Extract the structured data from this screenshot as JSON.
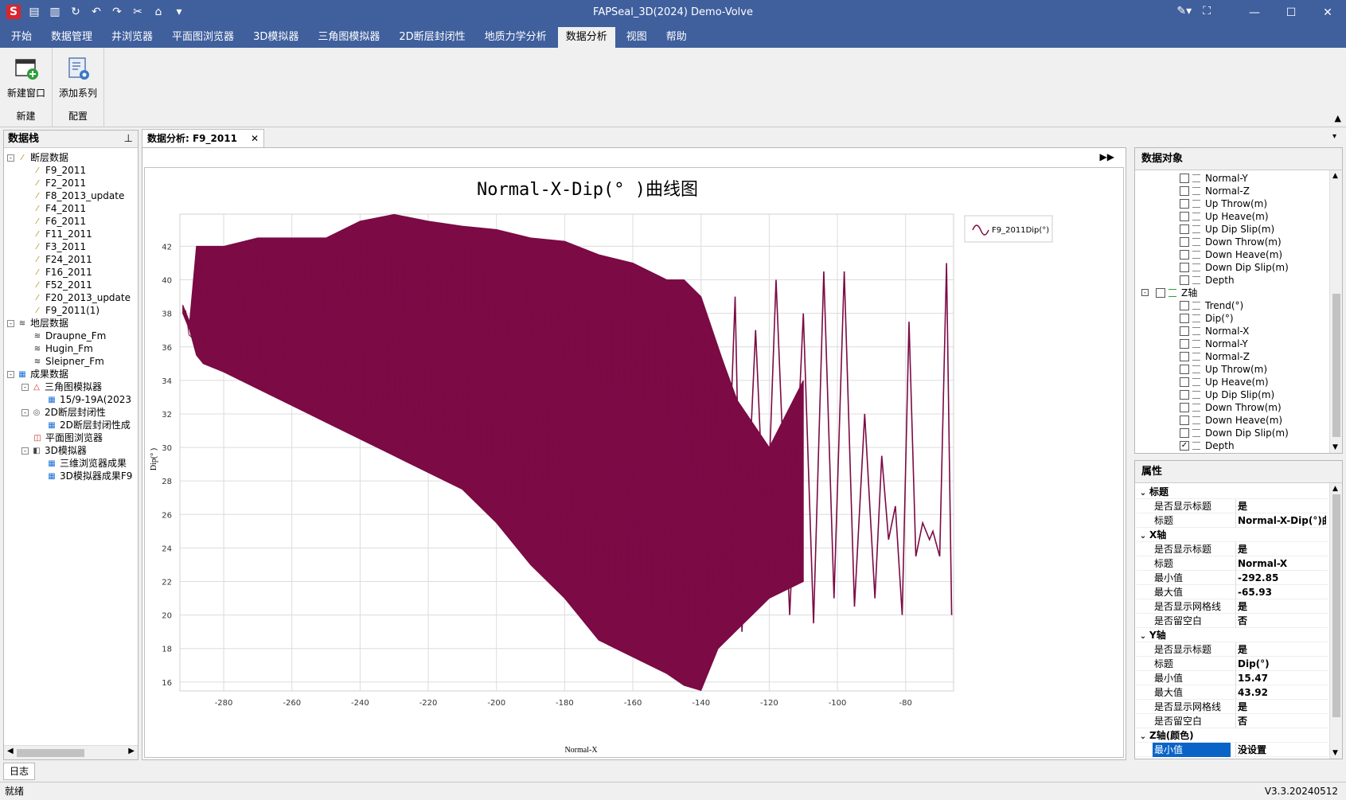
{
  "app": {
    "title": "FAPSeal_3D(2024) Demo-Volve",
    "logo": "S",
    "quick_access": [
      "save-icon",
      "save-all-icon",
      "refresh-icon",
      "undo-icon",
      "redo-icon",
      "cut-icon",
      "home-icon",
      "dropdown-icon"
    ]
  },
  "ribbon": {
    "tabs": [
      "开始",
      "数据管理",
      "井浏览器",
      "平面图浏览器",
      "3D模拟器",
      "三角图模拟器",
      "2D断层封闭性",
      "地质力学分析",
      "数据分析",
      "视图",
      "帮助"
    ],
    "active_tab": 8,
    "groups": [
      {
        "label": "新建",
        "buttons": [
          {
            "label": "新建窗口",
            "icon": "new-window-icon"
          }
        ]
      },
      {
        "label": "配置",
        "buttons": [
          {
            "label": "添加系列",
            "icon": "add-series-icon"
          }
        ]
      }
    ]
  },
  "left_panel": {
    "title": "数据栈",
    "tree": [
      {
        "label": "断层数据",
        "level": 0,
        "icon": "fault-icon",
        "exp": "-"
      },
      {
        "label": "F9_2011",
        "level": 1,
        "icon": "fault-icon"
      },
      {
        "label": "F2_2011",
        "level": 1,
        "icon": "fault-icon"
      },
      {
        "label": "F8_2013_update",
        "level": 1,
        "icon": "fault-icon"
      },
      {
        "label": "F4_2011",
        "level": 1,
        "icon": "fault-icon"
      },
      {
        "label": "F6_2011",
        "level": 1,
        "icon": "fault-icon"
      },
      {
        "label": "F11_2011",
        "level": 1,
        "icon": "fault-icon"
      },
      {
        "label": "F3_2011",
        "level": 1,
        "icon": "fault-icon"
      },
      {
        "label": "F24_2011",
        "level": 1,
        "icon": "fault-icon"
      },
      {
        "label": "F16_2011",
        "level": 1,
        "icon": "fault-icon"
      },
      {
        "label": "F52_2011",
        "level": 1,
        "icon": "fault-icon"
      },
      {
        "label": "F20_2013_update",
        "level": 1,
        "icon": "fault-icon"
      },
      {
        "label": "F9_2011(1)",
        "level": 1,
        "icon": "fault-icon"
      },
      {
        "label": "地层数据",
        "level": 0,
        "icon": "layer-icon",
        "exp": "-"
      },
      {
        "label": "Draupne_Fm",
        "level": 1,
        "icon": "layer-icon"
      },
      {
        "label": "Hugin_Fm",
        "level": 1,
        "icon": "layer-icon"
      },
      {
        "label": "Sleipner_Fm",
        "level": 1,
        "icon": "layer-icon"
      },
      {
        "label": "成果数据",
        "level": 0,
        "icon": "result-icon",
        "exp": "-"
      },
      {
        "label": "三角图模拟器",
        "level": 1,
        "icon": "triangle-icon",
        "exp": "-"
      },
      {
        "label": "15/9-19A(2023",
        "level": 2,
        "icon": "result-icon"
      },
      {
        "label": "2D断层封闭性",
        "level": 1,
        "icon": "seal-icon",
        "exp": "-"
      },
      {
        "label": "2D断层封闭性成",
        "level": 2,
        "icon": "result-icon"
      },
      {
        "label": "平面图浏览器",
        "level": 1,
        "icon": "map-icon"
      },
      {
        "label": "3D模拟器",
        "level": 1,
        "icon": "cube-icon",
        "exp": "-"
      },
      {
        "label": "三维浏览器成果",
        "level": 2,
        "icon": "result-icon"
      },
      {
        "label": "3D模拟器成果F9",
        "level": 2,
        "icon": "result-icon"
      }
    ]
  },
  "document": {
    "tab_label": "数据分析: F9_2011"
  },
  "chart_data": {
    "type": "line",
    "title": "Normal-X-Dip(° )曲线图",
    "xlabel": "Normal-X",
    "ylabel": "Dip(° )",
    "xlim": [
      -292.85,
      -65.93
    ],
    "ylim": [
      15.47,
      43.92
    ],
    "x_ticks": [
      -280,
      -260,
      -240,
      -220,
      -200,
      -180,
      -160,
      -140,
      -120,
      -100,
      -80
    ],
    "y_ticks": [
      16,
      18,
      20,
      22,
      24,
      26,
      28,
      30,
      32,
      34,
      36,
      38,
      40,
      42
    ],
    "grid": true,
    "legend_position": "top-right",
    "series": [
      {
        "name": "F9_2011Dip(°)",
        "color": "#7b0a45",
        "envelope": {
          "x": [
            -292,
            -290,
            -288,
            -286,
            -280,
            -270,
            -260,
            -250,
            -240,
            -230,
            -220,
            -210,
            -200,
            -190,
            -180,
            -170,
            -160,
            -150,
            -145,
            -140,
            -135,
            -130,
            -120,
            -110
          ],
          "upper": [
            38.5,
            37.5,
            42,
            42,
            42,
            42.5,
            42.5,
            42.5,
            43.5,
            43.9,
            43.5,
            43.2,
            43,
            42.5,
            42.3,
            41.5,
            41,
            40,
            40,
            39,
            36,
            33,
            30,
            34
          ],
          "lower": [
            38,
            37,
            35.5,
            35,
            34.5,
            33.5,
            32.5,
            31.5,
            30.5,
            29.5,
            28.5,
            27.5,
            25.5,
            23,
            21,
            18.5,
            17.5,
            16.5,
            15.8,
            15.5,
            18,
            19,
            21,
            22
          ]
        },
        "spikes": {
          "x": [
            -137,
            -133,
            -130,
            -128,
            -124,
            -121,
            -118,
            -114,
            -110,
            -107,
            -104,
            -101,
            -98,
            -95,
            -92,
            -89,
            -87,
            -85,
            -83,
            -81,
            -79,
            -77,
            -75,
            -73,
            -72,
            -70,
            -68,
            -66.5
          ],
          "y": [
            37,
            22,
            39,
            19,
            37,
            23,
            40,
            20,
            38,
            19.5,
            40.5,
            21,
            40.5,
            20.5,
            32,
            21,
            29.5,
            24.5,
            26.5,
            20,
            37.5,
            23.5,
            25.5,
            24.5,
            25,
            23.5,
            41,
            20
          ]
        }
      }
    ]
  },
  "object_panel": {
    "title": "数据对象",
    "items": [
      {
        "label": "Normal-Y",
        "level": 2,
        "checked": false
      },
      {
        "label": "Normal-Z",
        "level": 2,
        "checked": false
      },
      {
        "label": "Up Throw(m)",
        "level": 2,
        "checked": false
      },
      {
        "label": "Up Heave(m)",
        "level": 2,
        "checked": false
      },
      {
        "label": "Up Dip Slip(m)",
        "level": 2,
        "checked": false
      },
      {
        "label": "Down Throw(m)",
        "level": 2,
        "checked": false
      },
      {
        "label": "Down Heave(m)",
        "level": 2,
        "checked": false
      },
      {
        "label": "Down Dip Slip(m)",
        "level": 2,
        "checked": false
      },
      {
        "label": "Depth",
        "level": 2,
        "checked": false
      },
      {
        "label": "Z轴",
        "level": 1,
        "checked": false,
        "group": true
      },
      {
        "label": "Trend(°)",
        "level": 2,
        "checked": false
      },
      {
        "label": "Dip(°)",
        "level": 2,
        "checked": false
      },
      {
        "label": "Normal-X",
        "level": 2,
        "checked": false
      },
      {
        "label": "Normal-Y",
        "level": 2,
        "checked": false
      },
      {
        "label": "Normal-Z",
        "level": 2,
        "checked": false
      },
      {
        "label": "Up Throw(m)",
        "level": 2,
        "checked": false
      },
      {
        "label": "Up Heave(m)",
        "level": 2,
        "checked": false
      },
      {
        "label": "Up Dip Slip(m)",
        "level": 2,
        "checked": false
      },
      {
        "label": "Down Throw(m)",
        "level": 2,
        "checked": false
      },
      {
        "label": "Down Heave(m)",
        "level": 2,
        "checked": false
      },
      {
        "label": "Down Dip Slip(m)",
        "level": 2,
        "checked": false
      },
      {
        "label": "Depth",
        "level": 2,
        "checked": true
      }
    ]
  },
  "property_panel": {
    "title": "属性",
    "rows": [
      {
        "cat": "标题"
      },
      {
        "k": "是否显示标题",
        "v": "是"
      },
      {
        "k": "标题",
        "v": "Normal-X-Dip(°)曲线"
      },
      {
        "cat": "X轴"
      },
      {
        "k": "是否显示标题",
        "v": "是"
      },
      {
        "k": "标题",
        "v": "Normal-X"
      },
      {
        "k": "最小值",
        "v": "-292.85"
      },
      {
        "k": "最大值",
        "v": "-65.93"
      },
      {
        "k": "是否显示网格线",
        "v": "是"
      },
      {
        "k": "是否留空白",
        "v": "否"
      },
      {
        "cat": "Y轴"
      },
      {
        "k": "是否显示标题",
        "v": "是"
      },
      {
        "k": "标题",
        "v": "Dip(°)"
      },
      {
        "k": "最小值",
        "v": "15.47"
      },
      {
        "k": "最大值",
        "v": "43.92"
      },
      {
        "k": "是否显示网格线",
        "v": "是"
      },
      {
        "k": "是否留空白",
        "v": "否"
      },
      {
        "cat": "Z轴(颜色)"
      },
      {
        "k": "最小值",
        "v": "没设置",
        "selected": true
      }
    ]
  },
  "bottom": {
    "log_tab": "日志",
    "status": "就绪",
    "version": "V3.3.20240512"
  }
}
